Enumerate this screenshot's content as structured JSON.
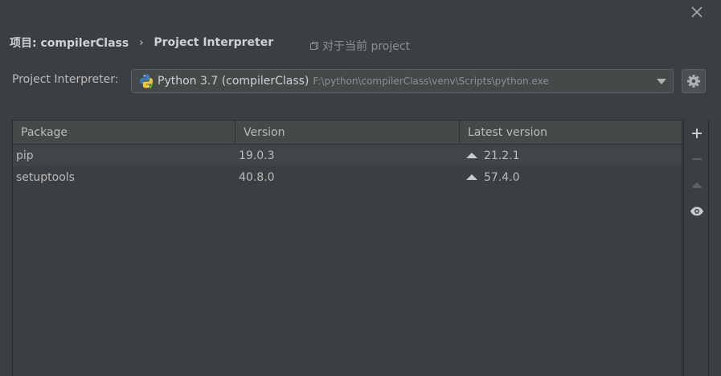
{
  "dialog": {
    "close_icon": "close-icon"
  },
  "breadcrumb": {
    "project": "项目: compilerClass",
    "separator": "›",
    "page": "Project Interpreter"
  },
  "scope_note": {
    "icon": "copy-icon",
    "text": "对于当前 project"
  },
  "interpreter": {
    "label": "Project Interpreter:",
    "icon": "python-icon",
    "name": "Python 3.7 (compilerClass)",
    "path": "F:\\python\\compilerClass\\venv\\Scripts\\python.exe",
    "settings_icon": "gear-icon"
  },
  "packages_table": {
    "columns": [
      "Package",
      "Version",
      "Latest version"
    ],
    "rows": [
      {
        "package": "pip",
        "version": "19.0.3",
        "latest": "21.2.1",
        "upgrade_icon": "upgrade-arrow-icon"
      },
      {
        "package": "setuptools",
        "version": "40.8.0",
        "latest": "57.4.0",
        "upgrade_icon": "upgrade-arrow-icon"
      }
    ]
  },
  "toolbar": {
    "add_icon": "plus-icon",
    "remove_icon": "minus-icon",
    "upgrade_icon": "upgrade-icon",
    "show_early_releases_icon": "eye-icon"
  },
  "colors": {
    "background": "#3c3f41",
    "header": "#45494a",
    "text": "#bbbbbb",
    "muted": "#8b9093",
    "python_blue": "#3e7ab3",
    "python_yellow": "#f0c53a"
  }
}
